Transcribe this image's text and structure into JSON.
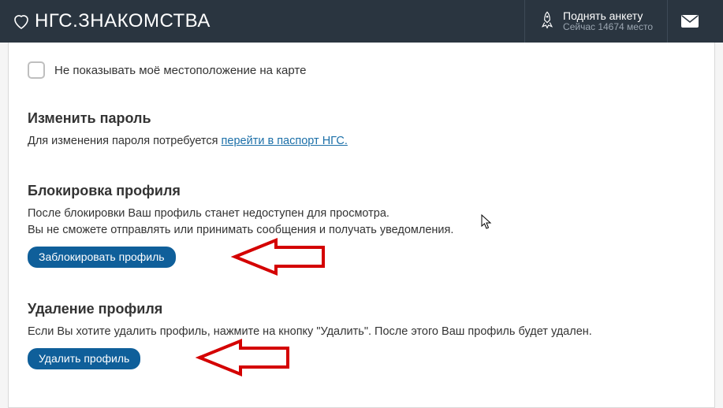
{
  "header": {
    "logo": "НГС.ЗНАКОМСТВА",
    "boost_title": "Поднять анкету",
    "boost_sub": "Сейчас 14674 место"
  },
  "checkbox": {
    "label": "Не показывать моё местоположение на карте"
  },
  "password": {
    "title": "Изменить пароль",
    "desc_prefix": "Для изменения пароля потребуется ",
    "link": "перейти в паспорт НГС."
  },
  "block": {
    "title": "Блокировка профиля",
    "line1": "После блокировки Ваш профиль станет недоступен для просмотра.",
    "line2": "Вы не сможете отправлять или принимать сообщения и получать уведомления.",
    "button": "Заблокировать профиль"
  },
  "delete": {
    "title": "Удаление профиля",
    "desc": "Если Вы хотите удалить профиль, нажмите на кнопку \"Удалить\". После этого Ваш профиль будет удален.",
    "button": "Удалить профиль"
  }
}
